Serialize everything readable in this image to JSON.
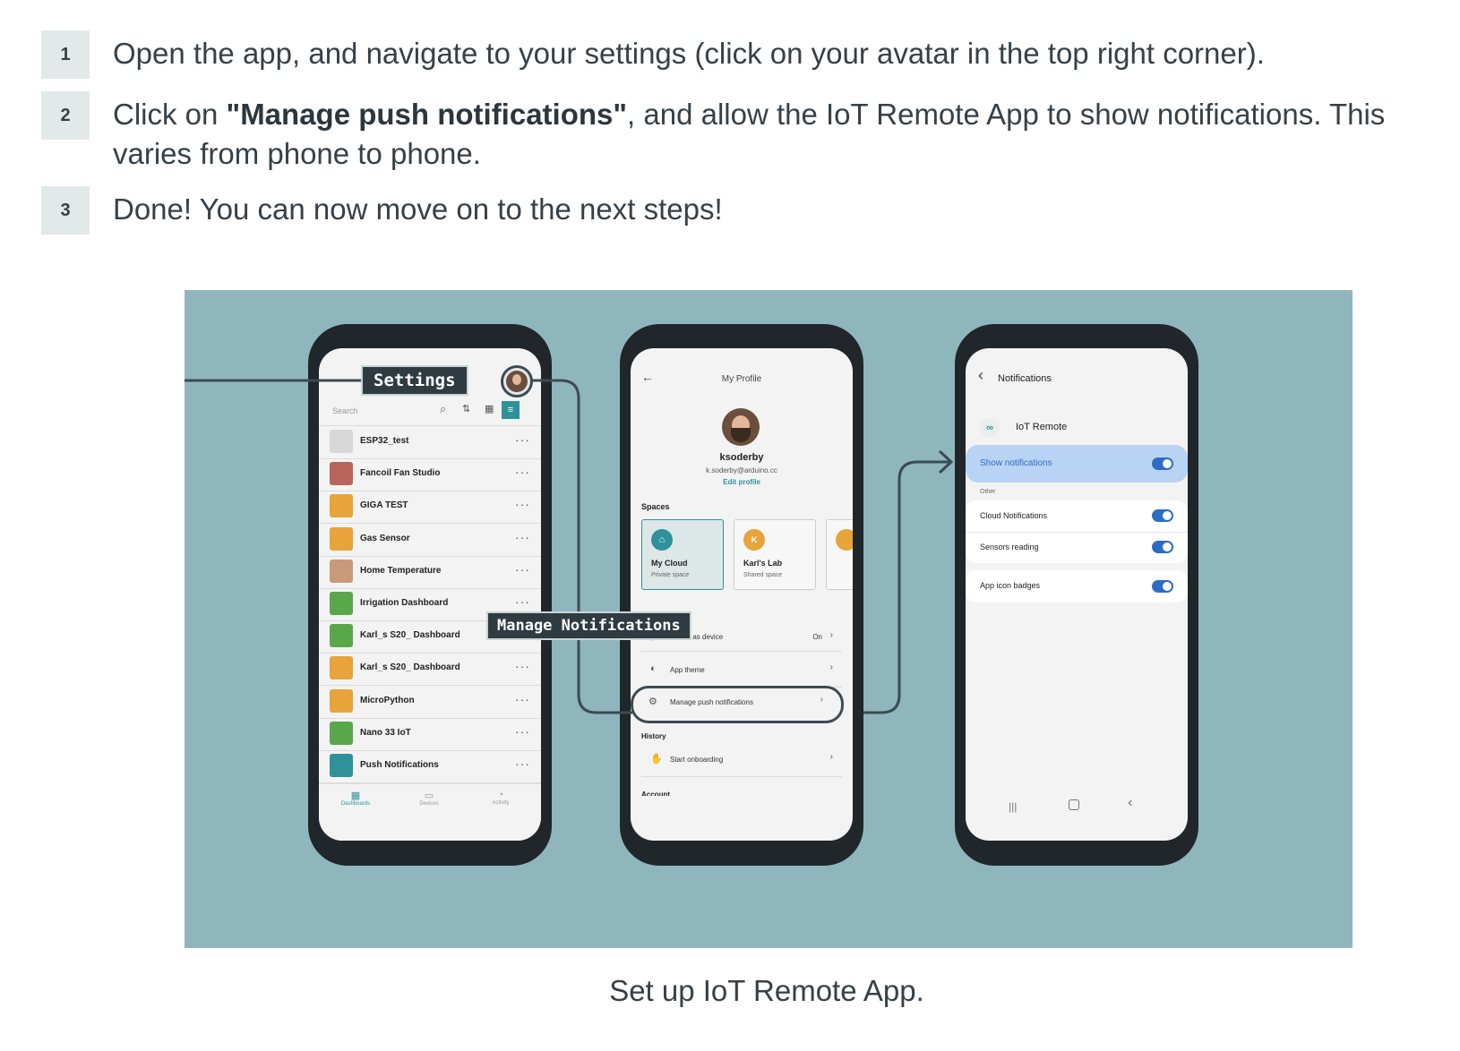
{
  "steps": [
    {
      "number": "1",
      "text": "Open the app, and navigate to your settings (click on your avatar in the top right corner)."
    },
    {
      "number": "2",
      "text_before": "Click on ",
      "bold": "\"Manage push notifications\"",
      "text_after": ", and allow the IoT Remote App to show notifications. This varies from phone to phone."
    },
    {
      "number": "3",
      "text": "Done! You can now move on to the next steps!"
    }
  ],
  "figure": {
    "caption": "Set up IoT Remote App.",
    "callout_settings": "Settings",
    "callout_manage": "Manage Notifications",
    "phone1": {
      "search_placeholder": "Search",
      "items": [
        "ESP32_test",
        "Fancoil Fan Studio",
        "GIGA TEST",
        "Gas Sensor",
        "Home Temperature",
        "Irrigation Dashboard",
        "Karl_s S20_ Dashboard",
        "Karl_s S20_ Dashboard",
        "MicroPython",
        "Nano 33 IoT",
        "Push Notifications"
      ],
      "nav": [
        "Dashboards",
        "Devices",
        "Activity"
      ]
    },
    "phone2": {
      "title": "My Profile",
      "username": "ksoderby",
      "email": "k.soderby@arduino.cc",
      "edit_profile": "Edit profile",
      "spaces_heading": "Spaces",
      "spaces": [
        {
          "initial": "⌂",
          "name": "My Cloud",
          "type": "Private space"
        },
        {
          "initial": "K",
          "name": "Karl's Lab",
          "type": "Shared space"
        }
      ],
      "phone_as_device": "Phone as device",
      "phone_as_device_value": "On",
      "app_theme": "App theme",
      "manage_push": "Manage push notifications",
      "history_heading": "History",
      "start_onboarding": "Start onboarding",
      "account_heading": "Account"
    },
    "phone3": {
      "title": "Notifications",
      "app_name": "IoT Remote",
      "show_notifications": "Show notifications",
      "other_heading": "Other",
      "settings": [
        "Cloud Notifications",
        "Sensors reading"
      ],
      "badges": "App icon badges"
    },
    "colors": {
      "figure_bg": "#8fb6bd",
      "teal": "#2f9199",
      "highlight": "#b8d3f4",
      "toggle": "#2d6cc4",
      "orange": "#e8a33b"
    }
  }
}
